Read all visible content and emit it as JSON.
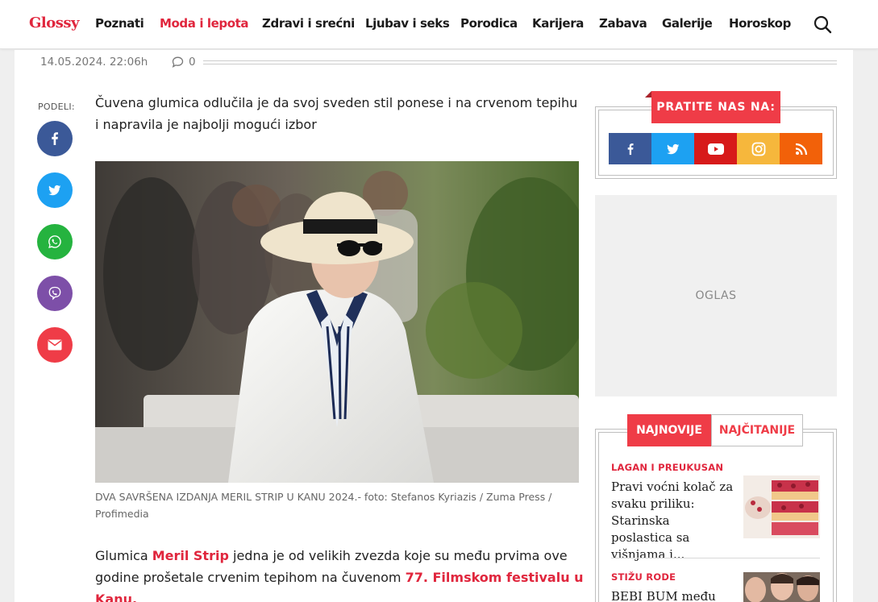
{
  "brand": {
    "logo_text": "Glossy",
    "accent": "#e0263d"
  },
  "nav": {
    "items": [
      {
        "label": "Poznati",
        "active": false
      },
      {
        "label": "Moda i lepota",
        "active": true
      },
      {
        "label": "Zdravi i srećni",
        "active": false
      },
      {
        "label": "Ljubav i seks",
        "active": false
      },
      {
        "label": "Porodica",
        "active": false
      },
      {
        "label": "Karijera",
        "active": false
      },
      {
        "label": "Zabava",
        "active": false
      },
      {
        "label": "Galerije",
        "active": false
      },
      {
        "label": "Horoskop",
        "active": false
      }
    ],
    "search_icon": "search-icon"
  },
  "article": {
    "date": "14.05.2024. 22:06h",
    "comments_count": "0",
    "share_label": "PODELI:",
    "share_buttons": [
      {
        "icon": "facebook-icon",
        "color": "#3b5998"
      },
      {
        "icon": "twitter-icon",
        "color": "#1da1f2"
      },
      {
        "icon": "whatsapp-icon",
        "color": "#25b33f"
      },
      {
        "icon": "viber-icon",
        "color": "#7d4fa8"
      },
      {
        "icon": "email-icon",
        "color": "#ef3c47"
      }
    ],
    "lead": "Čuvena glumica odlučila je da svoj sveden stil ponese i na crvenom tepihu i napravila je najbolji mogući izbor",
    "caption": "DVA SAVRŠENA IZDANJA MERIL STRIP U KANU 2024.- foto: Stefanos Kyriazis / Zuma Press / Profimedia",
    "body": {
      "part1": "Glumica ",
      "link1": "Meril Strip",
      "part2": " jedna je od velikih zvezda koje su među prvima ove godine prošetale crvenim tepihom na čuvenom ",
      "link2": "77. Filmskom festivalu u Kanu."
    }
  },
  "sidebar": {
    "follow_title": "PRATITE NAS NA:",
    "socials": [
      {
        "icon": "facebook-icon",
        "color": "#3b5998"
      },
      {
        "icon": "twitter-icon",
        "color": "#1da1f2"
      },
      {
        "icon": "youtube-icon",
        "color": "#d71a1a"
      },
      {
        "icon": "instagram-icon",
        "color": "#f6b73c"
      },
      {
        "icon": "rss-icon",
        "color": "#f26109"
      }
    ],
    "ad_label": "OGLAS",
    "tabs": {
      "latest": "NAJNOVIJE",
      "popular": "NAJČITANIJE"
    },
    "news": [
      {
        "kicker": "LAGAN I PREUKUSAN",
        "title": "Pravi voćni kolač za svaku priliku: Starinska poslastica sa višnjama i..."
      },
      {
        "kicker": "STIŽU RODE",
        "title": "BEBI BUM među"
      }
    ]
  }
}
